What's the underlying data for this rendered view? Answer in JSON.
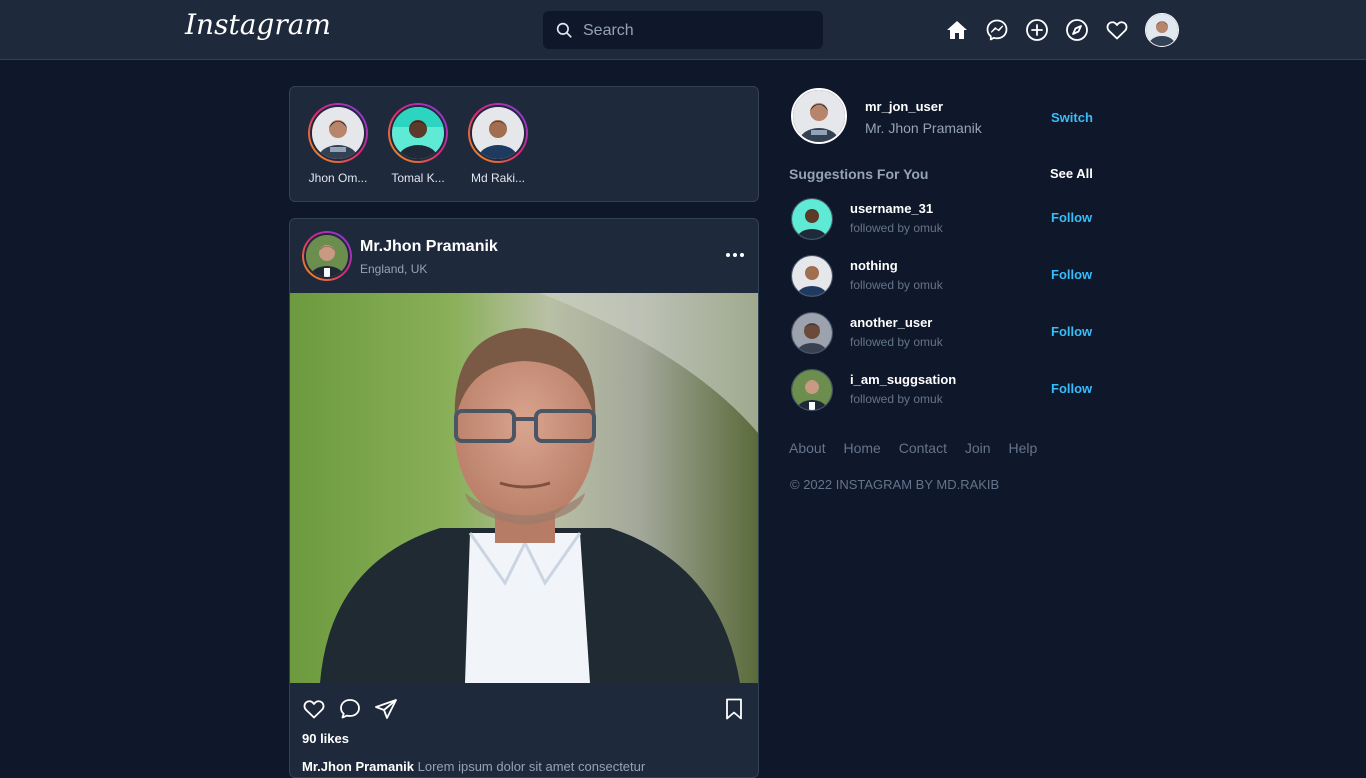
{
  "header": {
    "logo": "Instagram",
    "search": {
      "placeholder": "Search"
    },
    "nav_icons": [
      "home-icon",
      "messenger-icon",
      "plus-circle-icon",
      "compass-icon",
      "heart-icon"
    ]
  },
  "stories": [
    {
      "name": "Jhon Om..."
    },
    {
      "name": "Tomal K..."
    },
    {
      "name": "Md Raki..."
    }
  ],
  "post": {
    "username": "Mr.Jhon Pramanik",
    "location": "England, UK",
    "likes": "90 likes",
    "caption_user": "Mr.Jhon Pramanik",
    "caption_text": "Lorem ipsum dolor sit amet consectetur"
  },
  "sidebar": {
    "profile": {
      "username": "mr_jon_user",
      "full_name": "Mr. Jhon Pramanik",
      "switch_label": "Switch"
    },
    "suggestions_title": "Suggestions For You",
    "see_all_label": "See All",
    "suggestions": [
      {
        "username": "username_31",
        "subtitle": "followed by omuk",
        "action": "Follow"
      },
      {
        "username": "nothing",
        "subtitle": "followed by omuk",
        "action": "Follow"
      },
      {
        "username": "another_user",
        "subtitle": "followed by omuk",
        "action": "Follow"
      },
      {
        "username": "i_am_suggsation",
        "subtitle": "followed by omuk",
        "action": "Follow"
      }
    ],
    "footer_links": [
      "About",
      "Home",
      "Contact",
      "Join",
      "Help"
    ],
    "copyright": "© 2022 INSTAGRAM BY MD.RAKIB"
  },
  "colors": {
    "background": "#0f172a",
    "surface": "#1e293b",
    "accent": "#38bdf8"
  }
}
